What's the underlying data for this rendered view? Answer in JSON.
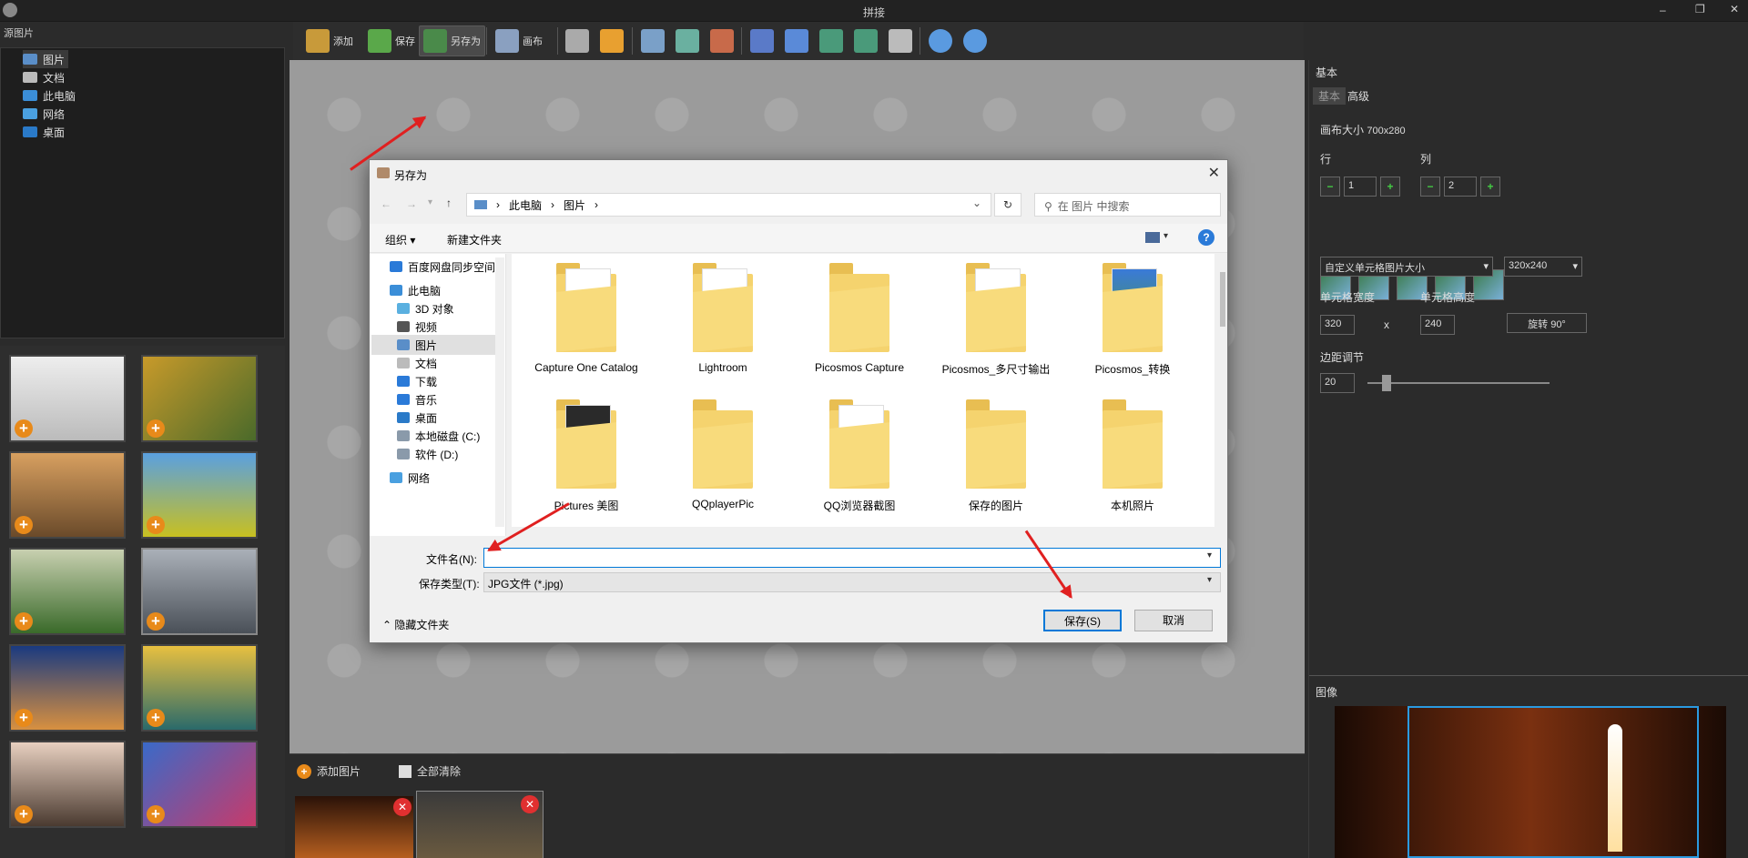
{
  "window": {
    "title": "拼接"
  },
  "toolbar": {
    "add": "添加",
    "save": "保存",
    "save_as": "另存为",
    "canvas": "画布"
  },
  "left_panel": {
    "header": "源图片",
    "tree": [
      "图片",
      "文档",
      "此电脑",
      "网络",
      "桌面"
    ]
  },
  "bottom_bar": {
    "add_images": "添加图片",
    "clear_all": "全部清除"
  },
  "right_panel": {
    "header": "基本",
    "tab_basic": "基本",
    "tab_advanced": "高级",
    "canvas_size_label": "画布大小",
    "canvas_size_value": "700x280",
    "rows_label": "行",
    "rows_value": "1",
    "cols_label": "列",
    "cols_value": "2",
    "cell_size_mode": "自定义单元格图片大小",
    "cell_size_preset": "320x240",
    "cell_width_label": "单元格宽度",
    "cell_height_label": "单元格高度",
    "cell_width": "320",
    "x_sep": "x",
    "cell_height": "240",
    "rotate_btn": "旋转 90°",
    "margin_label": "边距调节",
    "margin_value": "20",
    "image_header": "图像"
  },
  "dialog": {
    "title": "另存为",
    "breadcrumb": [
      "此电脑",
      "图片"
    ],
    "search_placeholder": "在 图片 中搜索",
    "organize": "组织",
    "new_folder": "新建文件夹",
    "nav": [
      "百度网盘同步空间",
      "此电脑",
      "3D 对象",
      "视频",
      "图片",
      "文档",
      "下载",
      "音乐",
      "桌面",
      "本地磁盘 (C:)",
      "软件 (D:)",
      "网络"
    ],
    "folders": [
      "Capture One Catalog",
      "Lightroom",
      "Picosmos Capture",
      "Picosmos_多尺寸输出",
      "Picosmos_转换",
      "Pictures 美图",
      "QQplayerPic",
      "QQ浏览器截图",
      "保存的图片",
      "本机照片"
    ],
    "filename_label": "文件名(N):",
    "filename_value": "",
    "filetype_label": "保存类型(T):",
    "filetype_value": "JPG文件 (*.jpg)",
    "hide_folders": "隐藏文件夹",
    "save_button": "保存(S)",
    "cancel_button": "取消"
  },
  "colors": {
    "accent_orange": "#e88a1a",
    "arrow_red": "#e02020",
    "dialog_blue": "#0078d7"
  }
}
